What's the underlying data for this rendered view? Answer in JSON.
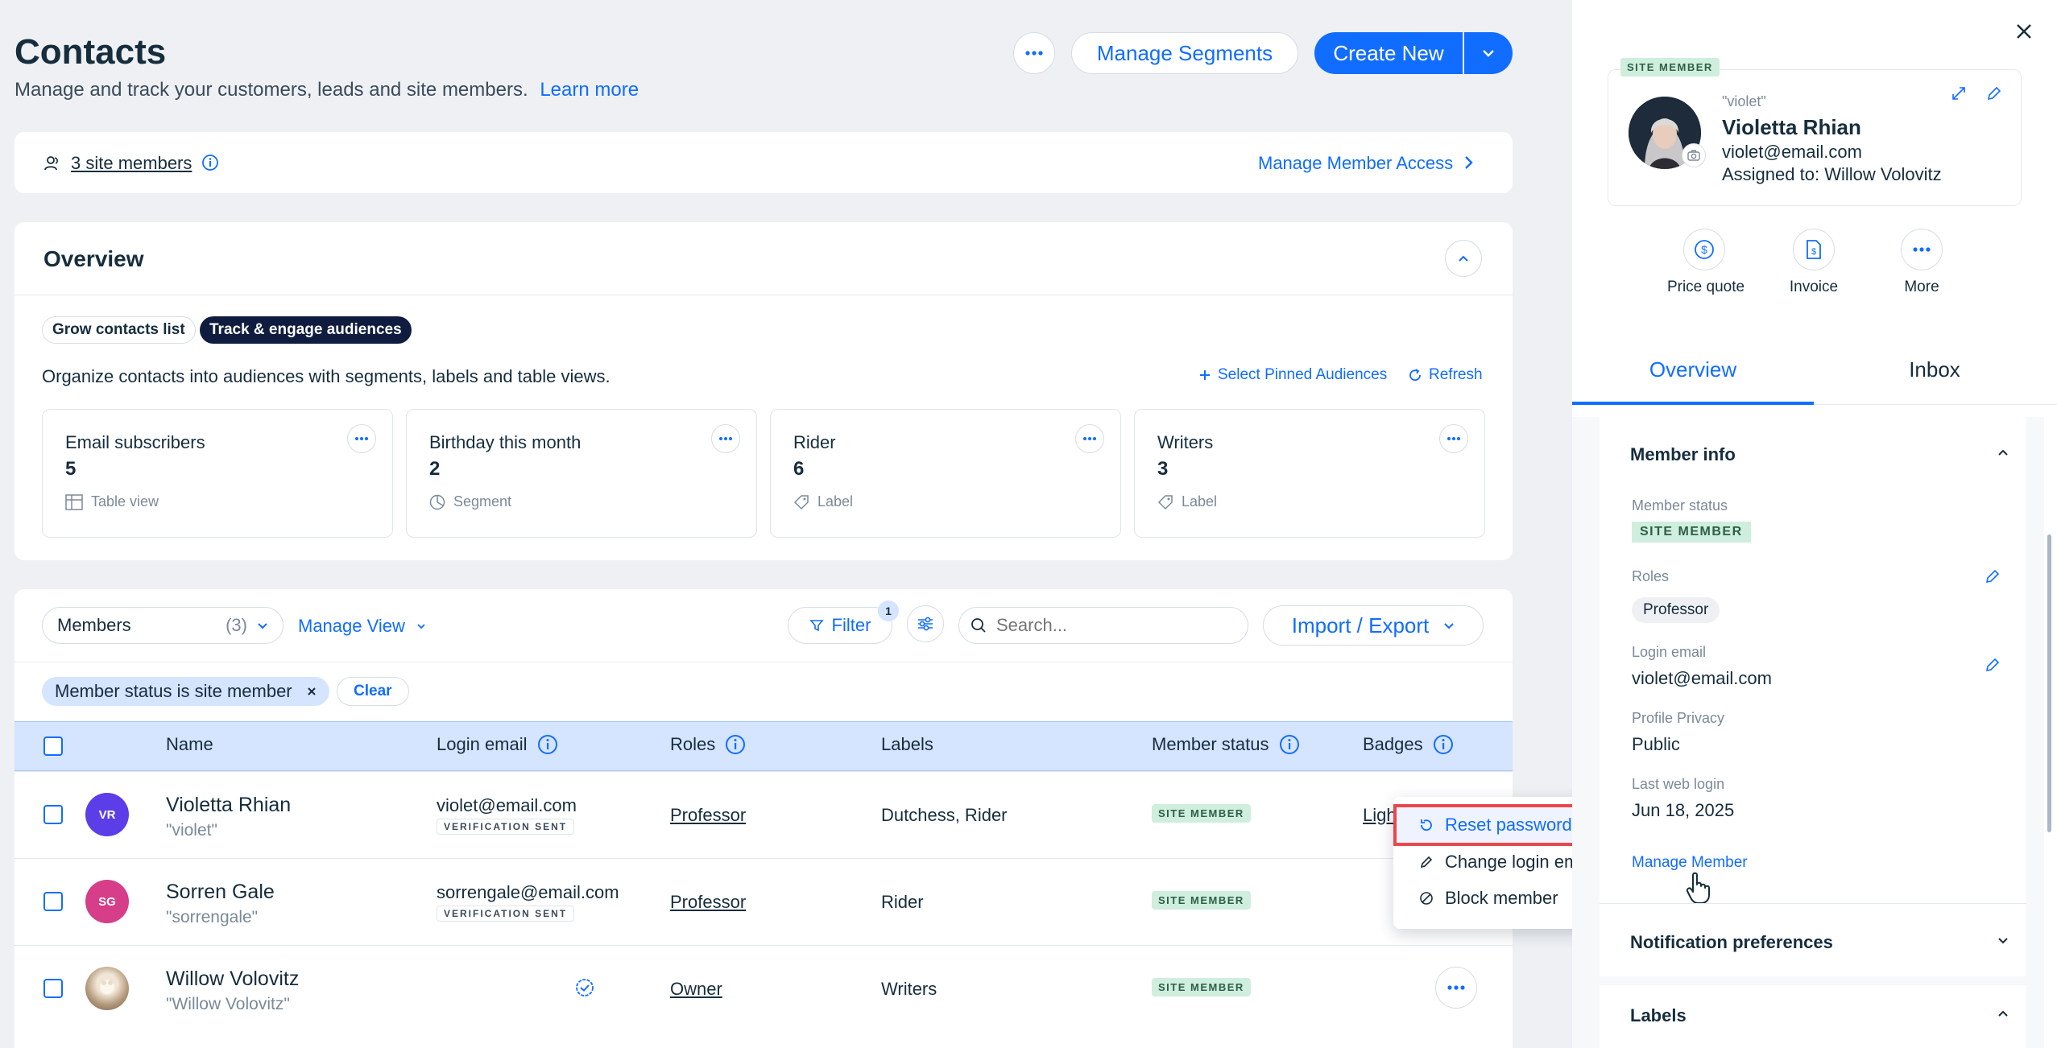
{
  "header": {
    "title": "Contacts",
    "subtitle": "Manage and track your customers, leads and site members.",
    "learn_more": "Learn more",
    "manage_segments": "Manage Segments",
    "create_new": "Create New"
  },
  "members_bar": {
    "count_link": "3 site members",
    "manage_access": "Manage Member Access"
  },
  "overview": {
    "title": "Overview",
    "tabs": [
      "Grow contacts list",
      "Track & engage audiences"
    ],
    "description": "Organize contacts into audiences with segments, labels and table views.",
    "select_pinned": "Select Pinned Audiences",
    "refresh": "Refresh",
    "audiences": [
      {
        "title": "Email subscribers",
        "count": "5",
        "kind": "Table view"
      },
      {
        "title": "Birthday this month",
        "count": "2",
        "kind": "Segment"
      },
      {
        "title": "Rider",
        "count": "6",
        "kind": "Label"
      },
      {
        "title": "Writers",
        "count": "3",
        "kind": "Label"
      }
    ]
  },
  "table_toolbar": {
    "view_select": "Members",
    "view_count": "(3)",
    "manage_view": "Manage View",
    "filter": "Filter",
    "filter_count": "1",
    "search_placeholder": "Search...",
    "import_export": "Import / Export",
    "active_filter": "Member status is site member",
    "clear": "Clear"
  },
  "table": {
    "columns": [
      "Name",
      "Login email",
      "Roles",
      "Labels",
      "Member status",
      "Badges"
    ],
    "rows": [
      {
        "initials": "VR",
        "name": "Violetta Rhian",
        "nick": "\"violet\"",
        "email": "violet@email.com",
        "verification": "VERIFICATION SENT",
        "role": "Professor",
        "labels": "Dutchess, Rider",
        "status": "SITE MEMBER",
        "badge": "Ligh"
      },
      {
        "initials": "SG",
        "name": "Sorren Gale",
        "nick": "\"sorrengale\"",
        "email": "sorrengale@email.com",
        "verification": "VERIFICATION SENT",
        "role": "Professor",
        "labels": "Rider",
        "status": "SITE MEMBER",
        "badge": ""
      },
      {
        "initials": "",
        "name": "Willow Volovitz",
        "nick": "\"Willow Volovitz\"",
        "email": "",
        "verification": "",
        "role": "Owner",
        "labels": "Writers",
        "status": "SITE MEMBER",
        "badge": ""
      }
    ]
  },
  "context_menu": {
    "items": [
      "Reset password",
      "Change login email",
      "Block member"
    ]
  },
  "panel": {
    "badge": "SITE MEMBER",
    "nickname": "\"violet\"",
    "name": "Violetta Rhian",
    "email": "violet@email.com",
    "assigned": "Assigned to: Willow Volovitz",
    "actions": [
      "Price quote",
      "Invoice",
      "More"
    ],
    "tabs": [
      "Overview",
      "Inbox"
    ],
    "member_info": {
      "title": "Member info",
      "status_label": "Member status",
      "status_value": "SITE MEMBER",
      "roles_label": "Roles",
      "roles_value": "Professor",
      "login_email_label": "Login email",
      "login_email_value": "violet@email.com",
      "privacy_label": "Profile Privacy",
      "privacy_value": "Public",
      "last_login_label": "Last web login",
      "last_login_value": "Jun 18, 2025",
      "manage_member": "Manage Member"
    },
    "sections": [
      "Notification preferences",
      "Labels"
    ]
  },
  "colors": {
    "accent": "#116dff",
    "dark": "#162d3d",
    "highlight": "#e8484b",
    "badge_bg": "#cfeedd"
  }
}
